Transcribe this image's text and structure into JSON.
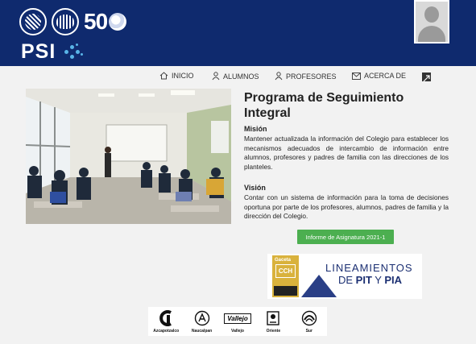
{
  "header": {
    "logo_fifty": "50",
    "psi_label": "PSI"
  },
  "nav": [
    {
      "label": "INICIO",
      "icon": "home-icon"
    },
    {
      "label": "ALUMNOS",
      "icon": "student-icon"
    },
    {
      "label": "PROFESORES",
      "icon": "teacher-icon"
    },
    {
      "label": "ACERCA DE",
      "icon": "mail-icon"
    }
  ],
  "main": {
    "title": "Programa de Seguimiento Integral",
    "mision_heading": "Misión",
    "mision_text": "Mantener actualizada la información del Colegio para establecer los mecanismos adecuados de intercambio de información entre alumnos, profesores y padres de familia con las direcciones de los planteles.",
    "vision_heading": "Visión",
    "vision_text": "Contar con un sistema de información para la toma de decisiones oportuna por parte de los profesores, alumnos, padres de familia y la dirección del Colegio.",
    "report_button": "Informe de Asignatura 2021-1"
  },
  "banner": {
    "gaceta_label": "Gaceta",
    "cch_label": "CCH",
    "line1": "LINEAMIENTOS",
    "line2_prefix": "DE ",
    "pit": "PIT",
    "connector": " Y ",
    "pia": "PIA"
  },
  "planteles": [
    {
      "name": "Azcapotzalco",
      "icon": "azcapotzalco-logo-icon"
    },
    {
      "name": "Naucalpan",
      "icon": "naucalpan-logo-icon"
    },
    {
      "name": "Vallejo",
      "icon": "vallejo-logo-icon",
      "mark_text": "Vallejo"
    },
    {
      "name": "Oriente",
      "icon": "oriente-logo-icon"
    },
    {
      "name": "Sur",
      "icon": "sur-logo-icon"
    }
  ],
  "colors": {
    "header_bg": "#0f2a6e",
    "button_bg": "#4caf50",
    "accent_dots": "#59b5e8"
  }
}
